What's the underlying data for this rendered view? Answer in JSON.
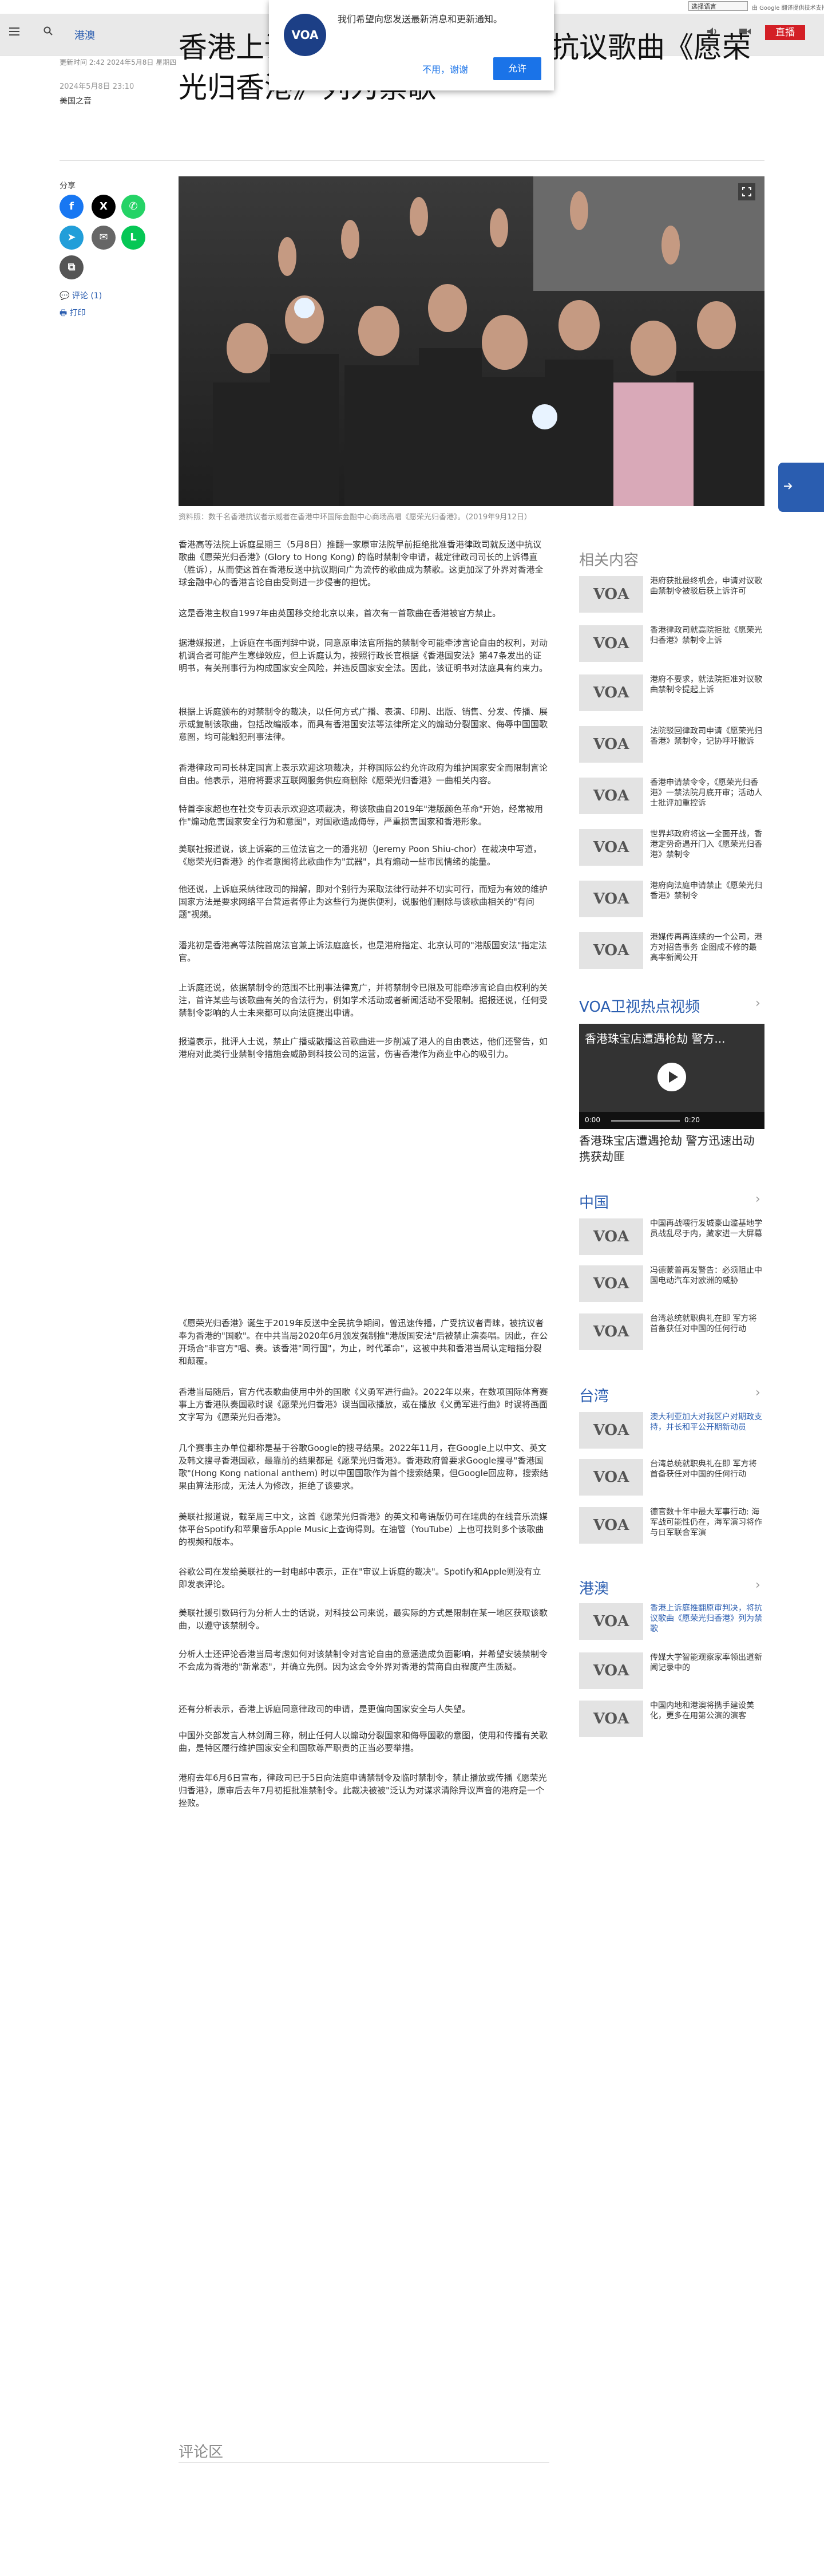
{
  "translate_bar": {
    "select_label": "选择语言",
    "powered": "由 Google 翻译提供技术支持"
  },
  "header": {
    "section": "港澳",
    "live": "直播"
  },
  "notification": {
    "message": "我们希望向您发送最新消息和更新通知。",
    "decline": "不用，谢谢",
    "accept": "允许",
    "logo": "VOA"
  },
  "article": {
    "updated": "更新时间 2:42 2024年5月8日 星期四",
    "date": "2024年5月8日 23:10",
    "author": "美国之音",
    "headline": "香港上诉庭推翻原审判决，将抗议歌曲《愿荣光归香港》列为禁歌",
    "caption": "资料照：数千名香港抗议者示威者在香港中环国际金融中心商场高唱《愿荣光归香港》。（2019年9月12日）",
    "paragraphs": [
      "香港高等法院上诉庭星期三（5月8日）推翻一家原审法院早前拒绝批准香港律政司就反送中抗议歌曲《愿荣光归香港》(Glory to Hong Kong) 的临时禁制令申请，裁定律政司司长的上诉得直（胜诉），从而使这首在香港反送中抗议期间广为流传的歌曲成为禁歌。这更加深了外界对香港全球金融中心的香港言论自由受到进一步侵害的担忧。",
      "这是香港主权自1997年由英国移交给北京以来，首次有一首歌曲在香港被官方禁止。",
      "据港媒报道，上诉庭在书面判辞中说，同意原审法官所指的禁制令可能牵涉言论自由的权利，对动机调合者可能产生寒蝉效应，但上诉庭认为，按照行政长官根据《香港国安法》第47条发出的证明书，有关刑事行为构成国家安全风险，并违反国家安全法。因此，该证明书对法庭具有约束力。",
      "根据上诉庭颁布的对禁制令的裁决，以任何方式广播、表演、印刷、出版、销售、分发、传播、展示或复制该歌曲，包括改编版本，而具有香港国安法等法律所定义的煽动分裂国家、侮辱中国国歌意图，均可能触犯刑事法律。",
      "香港律政司司长林定国言上表示欢迎这项裁决，并称国际公约允许政府为维护国家安全而限制言论自由。他表示，港府将要求互联网服务供应商删除《愿荣光归香港》一曲相关内容。",
      "特首李家超也在社交专页表示欢迎这项裁决，称该歌曲自2019年\"港版颜色革命\"开始，经常被用作\"煽动危害国家安全行为和意图\"，对国歌造成侮辱，严重损害国家和香港形象。",
      "美联社报道说，该上诉案的三位法官之一的潘兆初（Jeremy Poon Shiu-chor）在裁决中写道，《愿荣光归香港》的作者意图将此歌曲作为\"武器\"，具有煽动一些市民情绪的能量。",
      "他还说，上诉庭采纳律政司的辩解，即对个别行为采取法律行动并不切实可行，而短为有效的维护国家方法是要求网络平台营运者停止为这些行为提供便利，说服他们删除与该歌曲相关的\"有问题\"视频。",
      "潘兆初是香港高等法院首席法官兼上诉法庭庭长，也是港府指定、北京认可的\"港版国安法\"指定法官。",
      "上诉庭还说，依据禁制令的范围不比刑事法律宽广，并将禁制令已限及可能牵涉言论自由权利的关注，首许某些与该歌曲有关的合法行为，例如学术活动或者新闻活动不受限制。据报还说，任何受禁制令影响的人士未来都可以向法庭提出申请。",
      "报道表示，批评人士说，禁止广播或散播这首歌曲进一步削减了港人的自由表达，他们还警告，如港府对此类行业禁制令措施会威胁到科技公司的运营，伤害香港作为商业中心的吸引力。",
      "《愿荣光归香港》诞生于2019年反送中全民抗争期间，曾迅速传播，广受抗议者青睐，被抗议者奉为香港的\"国歌\"。在中共当局2020年6月颁发强制推\"港版国安法\"后被禁止演奏唱。因此，在公开场合\"非官方\"唱、奏。该香港\"同行国\"，为止，时代革命\"，这被中共和香港当局认定暗指分裂和颠覆。",
      "香港当局随后，官方代表歌曲使用中外的国歌《义勇军进行曲》。2022年以来，在数项国际体育赛事上方香港队奏国歌时误《愿荣光归香港》误当国歌播放，或在播放《义勇军进行曲》时误将画面文字写为《愿荣光归香港》。",
      "几个赛事主办单位都称是基于谷歌Google的搜寻结果。2022年11月，在Google上以中文、英文及韩文搜寻香港国歌，最靠前的结果都是《愿荣光归香港》。香港政府曾要求Google搜寻\"香港国歌\"(Hong Kong national anthem) 时以中国国歌作为首个搜索结果，但Google回应称，搜索结果由算法形成，无法人为修改，拒绝了该要求。",
      "美联社报道说，截至周三中文，这首《愿荣光归香港》的英文和粤语版仍可在瑞典的在线音乐流媒体平台Spotify和苹果音乐Apple Music上查询得到。在油管（YouTube）上也可找到多个该歌曲的视频和版本。",
      "谷歌公司在发给美联社的一封电邮中表示，正在\"审议上诉庭的裁决\"。Spotify和Apple则没有立即发表评论。",
      "美联社援引数码行为分析人士的话说，对科技公司来说，最实际的方式是限制在某一地区获取该歌曲，以遵守该禁制令。",
      "分析人士还评论香港当局考虑如何对该禁制令对言论自由的意涵造成负面影响，并希望安装禁制令不会成为香港的\"新常态\"，并确立先例。因为这会令外界对香港的营商自由程度产生质疑。",
      "还有分析表示，香港上诉庭同意律政司的申请，是更偏向国家安全与人失望。",
      "中国外交部发言人林剑周三称，制止任何人以煽动分裂国家和侮辱国歌的意图，使用和传播有关歌曲，是特区履行维护国家安全和国歌尊严职责的正当必要举措。",
      "港府去年6月6日宣布，律政司已于5日向法庭申请禁制令及临时禁制令，禁止播放或传播《愿荣光归香港》，原审后去年7月初拒批准禁制令。此裁决被被\"泛认为对谋求清除异议声音的港府是一个挫败。"
    ]
  },
  "share": {
    "label": "分享",
    "comments": "评论 (1)",
    "print": "打印"
  },
  "sidebar": {
    "related_title": "相关内容",
    "related": [
      "港府获批最终机会，申请对议歌曲禁制令被驳后获上诉许可",
      "香港律政司就高院拒批《愿荣光归香港》禁制令上诉",
      "港府不要求，就法院拒准对议歌曲禁制令提起上诉",
      "法院驳回律政司申请《愿荣光归香港》禁制令，记协呼吁撤诉",
      "香港申请禁令令，《愿荣光归香港》一禁法院月底开审；活动人士批评加重控诉",
      "世界邦政府将这一全面开战，香港定势奇遇开门入《愿荣光归香港》禁制令",
      "港府向法庭申请禁止《愿荣光归香港》禁制令",
      "港媒传再再连续的一个公司，港方对招告事务 企图成不修的最高率新闻公开"
    ],
    "video_title": "VOA卫视热点视频",
    "video_overlay": "香港珠宝店遭遇枪劫 警方...",
    "video_time": "0:00",
    "video_duration": "0:20",
    "video_caption": "香港珠宝店遭遇抢劫 警方迅速出动 携获劫匪",
    "china_title": "中国",
    "china": [
      "中国再战喂行发城豪山滥基地学员战乱尽于内，藏家进一大屏幕",
      "冯德蒙普再发警告：必须阻止中国电动汽车对欧洲的威胁",
      "台湾总统就职典礼在即 军方将首备获任对中国的任何行动"
    ],
    "taiwan_title": "台湾",
    "taiwan": [
      "澳大利亚加大对我区户对期政支持，并长和平公开期新动员",
      "台湾总统就职典礼在即 军方将首备获任对中国的任何行动",
      "德官数十年中最大军事行动: 海军战可能性仍在，海军演习将作与日军联合军演"
    ],
    "hkmacau_title": "港澳",
    "hkmacau": [
      "香港上诉庭推翻原审判决，将抗议歌曲《愿荣光归香港》列为禁歌",
      "传媒大学智能观察家率领出道新闻记录中的",
      "中国内地和港澳将携手建设美化，更多在用第公演的演客"
    ]
  },
  "comments_title": "评论区"
}
